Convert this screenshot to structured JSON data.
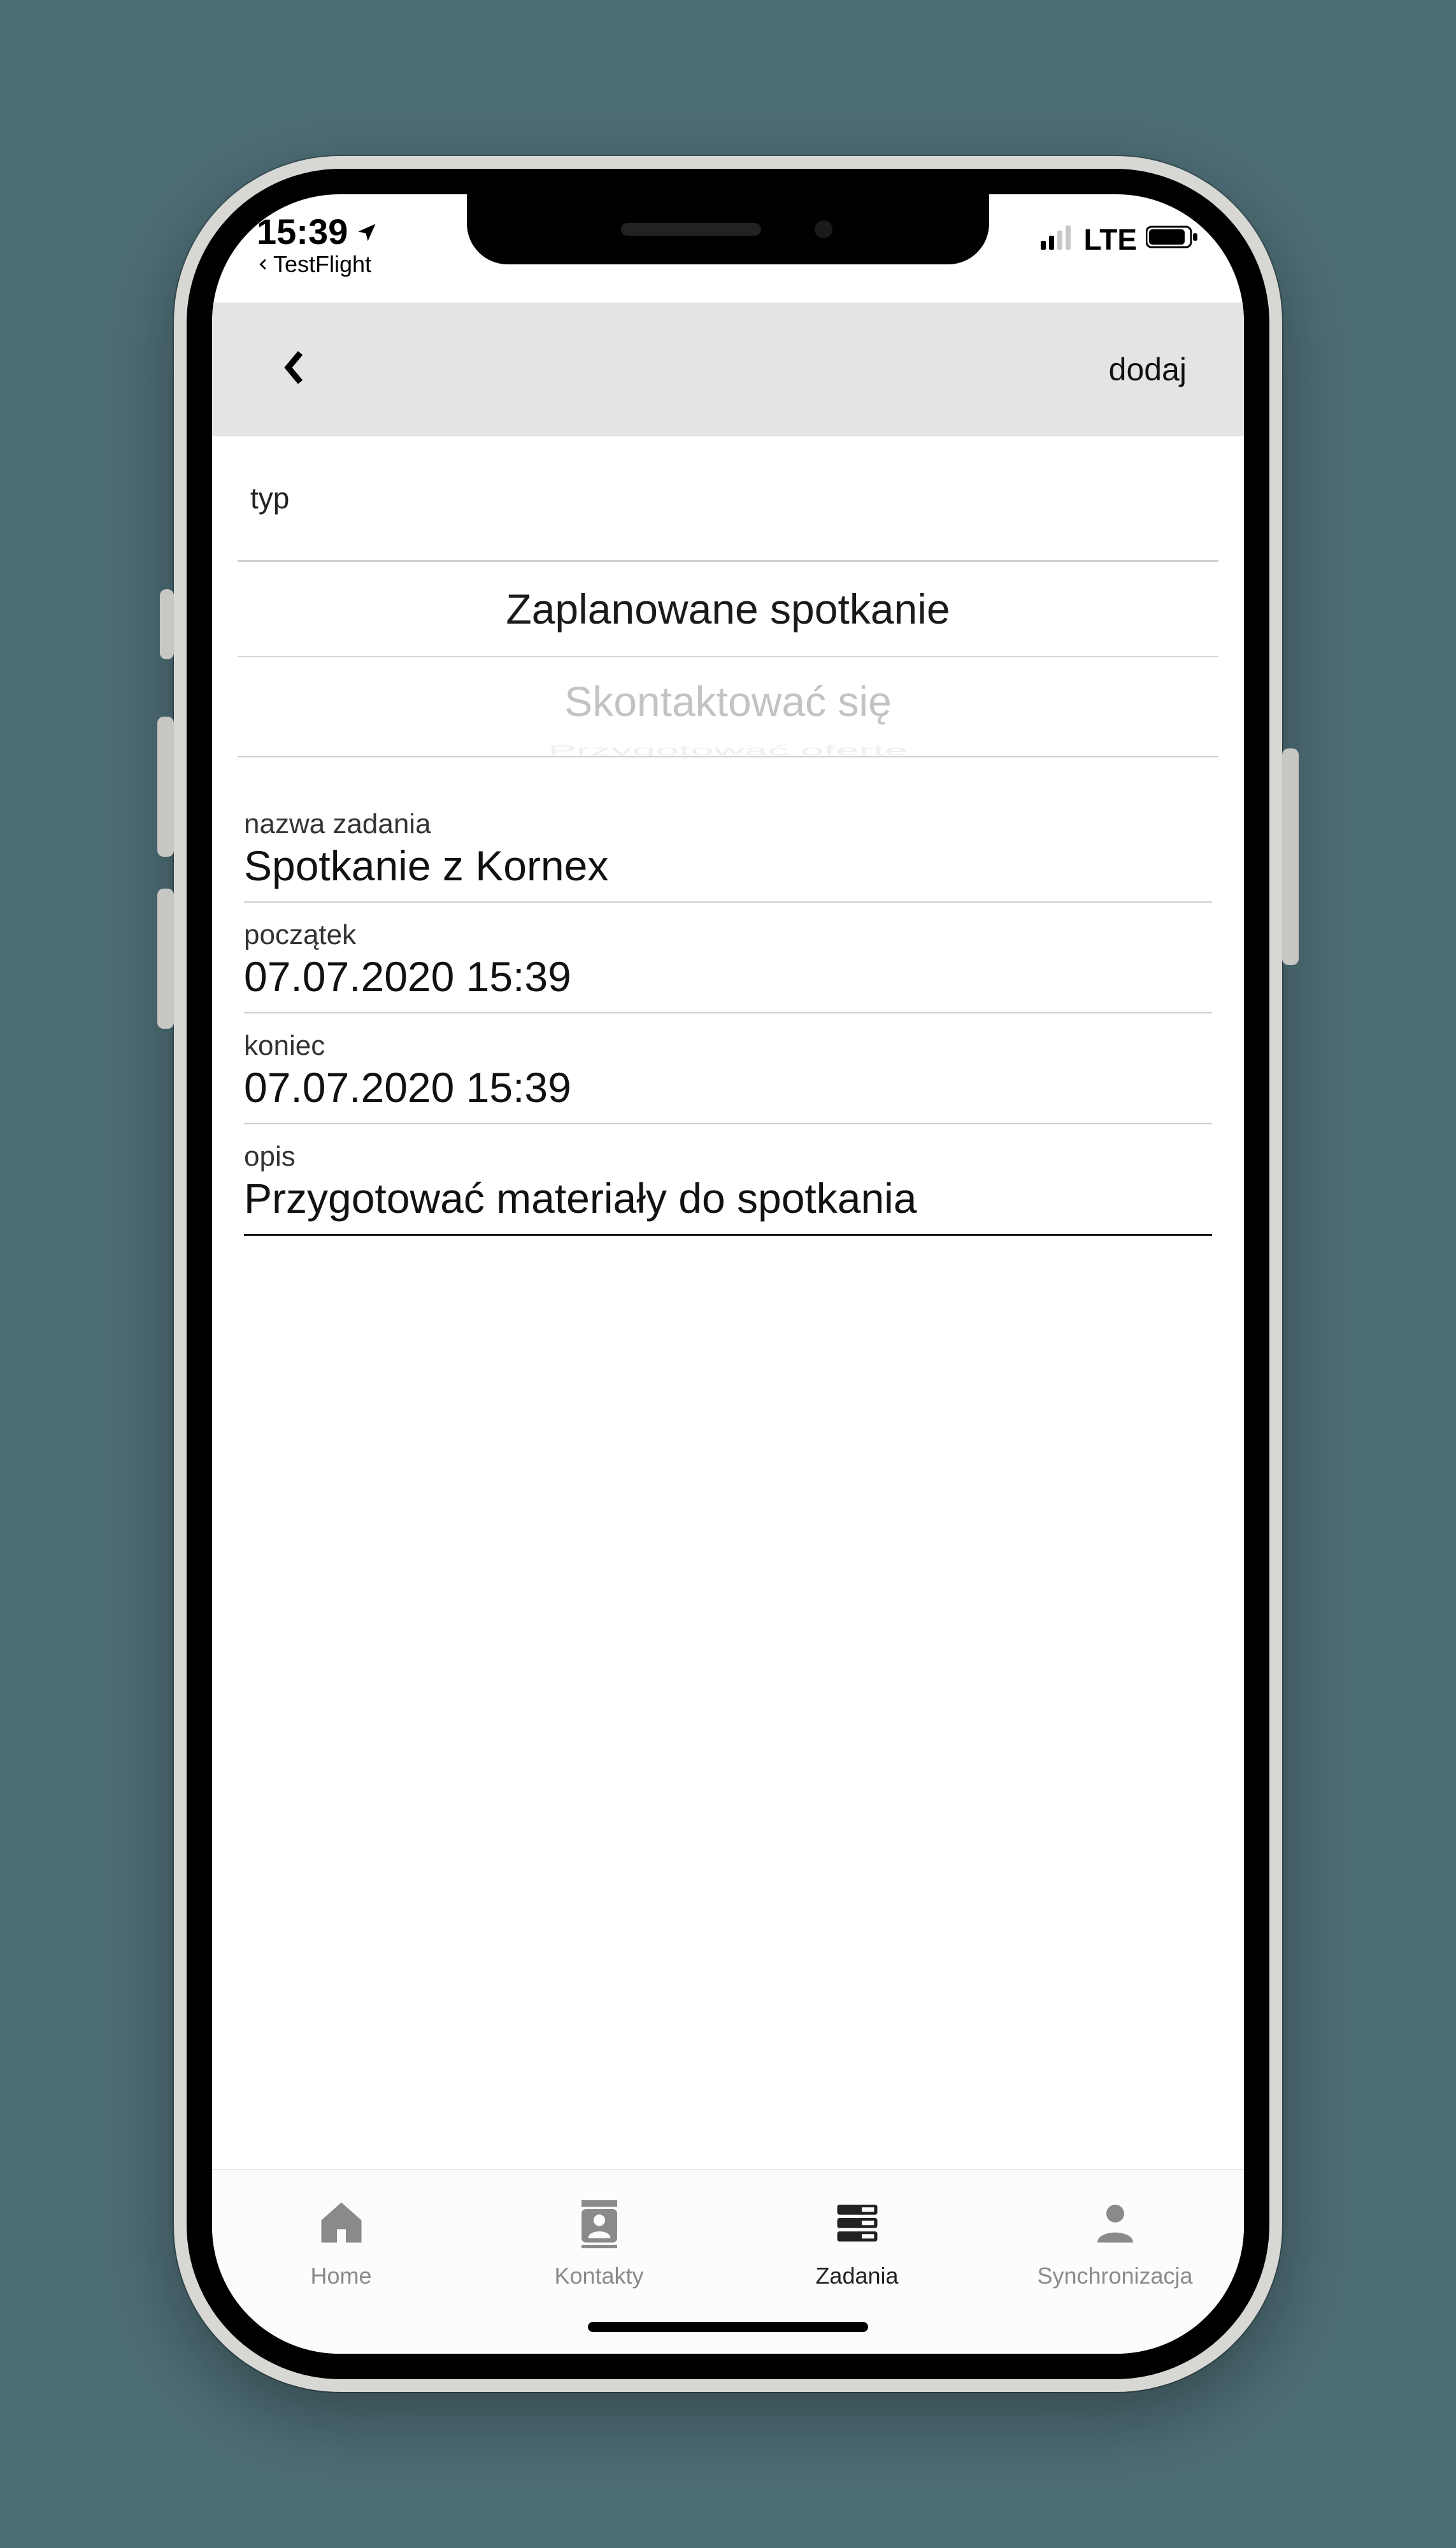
{
  "statusbar": {
    "time": "15:39",
    "back_app_label": "TestFlight",
    "network_label": "LTE"
  },
  "header": {
    "action_label": "dodaj"
  },
  "form": {
    "type_label": "typ",
    "picker": {
      "selected": "Zaplanowane spotkanie",
      "next": "Skontaktować się",
      "next2": "Przygotować ofertę"
    },
    "task_name_label": "nazwa zadania",
    "task_name_value": "Spotkanie z Kornex",
    "start_label": "początek",
    "start_value": "07.07.2020 15:39",
    "end_label": "koniec",
    "end_value": "07.07.2020 15:39",
    "description_label": "opis",
    "description_value": "Przygotować materiały do spotkania"
  },
  "tabs": {
    "home": "Home",
    "contacts": "Kontakty",
    "tasks": "Zadania",
    "sync": "Synchronizacja"
  }
}
